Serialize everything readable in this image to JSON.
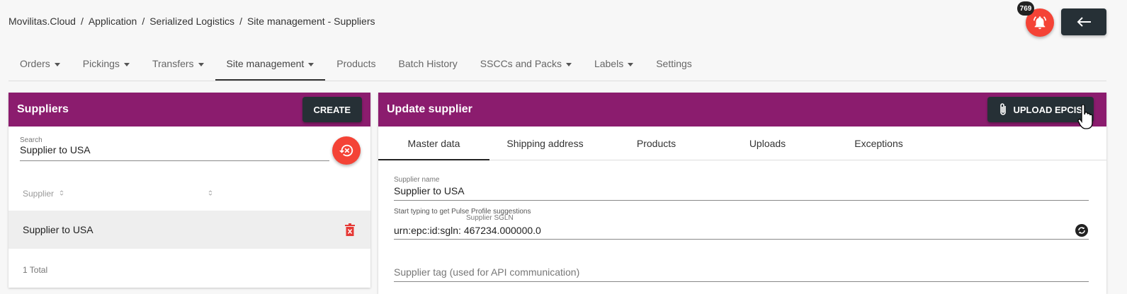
{
  "breadcrumb": [
    "Movilitas.Cloud",
    "Application",
    "Serialized Logistics",
    "Site management - Suppliers"
  ],
  "breadcrumb_sep": "/",
  "notifications": {
    "count": "769",
    "icon": "bell-icon"
  },
  "back": {
    "icon": "arrow-left-icon"
  },
  "nav": [
    {
      "label": "Orders",
      "dropdown": true
    },
    {
      "label": "Pickings",
      "dropdown": true
    },
    {
      "label": "Transfers",
      "dropdown": true
    },
    {
      "label": "Site management",
      "dropdown": true,
      "active": true
    },
    {
      "label": "Products",
      "dropdown": false
    },
    {
      "label": "Batch History",
      "dropdown": false
    },
    {
      "label": "SSCCs and Packs",
      "dropdown": true
    },
    {
      "label": "Labels",
      "dropdown": true
    },
    {
      "label": "Settings",
      "dropdown": false
    }
  ],
  "suppliers": {
    "title": "Suppliers",
    "create_label": "CREATE",
    "search_label": "Search",
    "search_value": "Supplier to USA",
    "column_header": "Supplier",
    "rows": [
      {
        "name": "Supplier to USA"
      }
    ],
    "total": "1 Total"
  },
  "update": {
    "title": "Update supplier",
    "upload_label": "UPLOAD EPCIS",
    "tabs": [
      "Master data",
      "Shipping address",
      "Products",
      "Uploads",
      "Exceptions"
    ],
    "supplier_name_label": "Supplier name",
    "supplier_name_value": "Supplier to USA",
    "hint": "Start typing to get Pulse Profile suggestions",
    "sgln_label": "Supplier SGLN",
    "sgln_value": "urn:epc:id:sgln: 467234.000000.0",
    "tag_placeholder": "Supplier tag (used for API communication)"
  },
  "colors": {
    "header": "#8b1c6e",
    "accent_red": "#f44336",
    "dark_button": "#263036"
  }
}
